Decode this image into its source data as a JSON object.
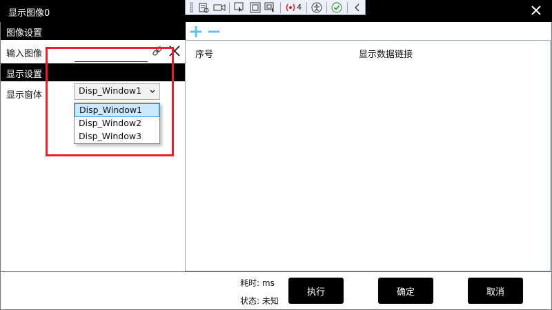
{
  "window": {
    "title": "显示图像0",
    "close_icon": "close-icon"
  },
  "devtools": {
    "error_count": "4"
  },
  "left": {
    "image_settings_header": "图像设置",
    "input_image_label": "输入图像",
    "display_settings_header": "显示设置",
    "display_window_label": "显示窗体",
    "combo_value": "Disp_Window1",
    "options": [
      "Disp_Window1",
      "Disp_Window2",
      "Disp_Window3"
    ],
    "selected_option_index": 0
  },
  "right": {
    "col_index": "序号",
    "col_link": "显示数据链接"
  },
  "footer": {
    "time_label": "耗时:",
    "time_value": "ms",
    "status_label": "状态:",
    "status_value": "未知",
    "run_label": "执行",
    "ok_label": "确定",
    "cancel_label": "取消"
  },
  "colors": {
    "accent_plus": "#5bc0eb",
    "highlight": "#e5202a",
    "selection": "#cce8ff"
  }
}
